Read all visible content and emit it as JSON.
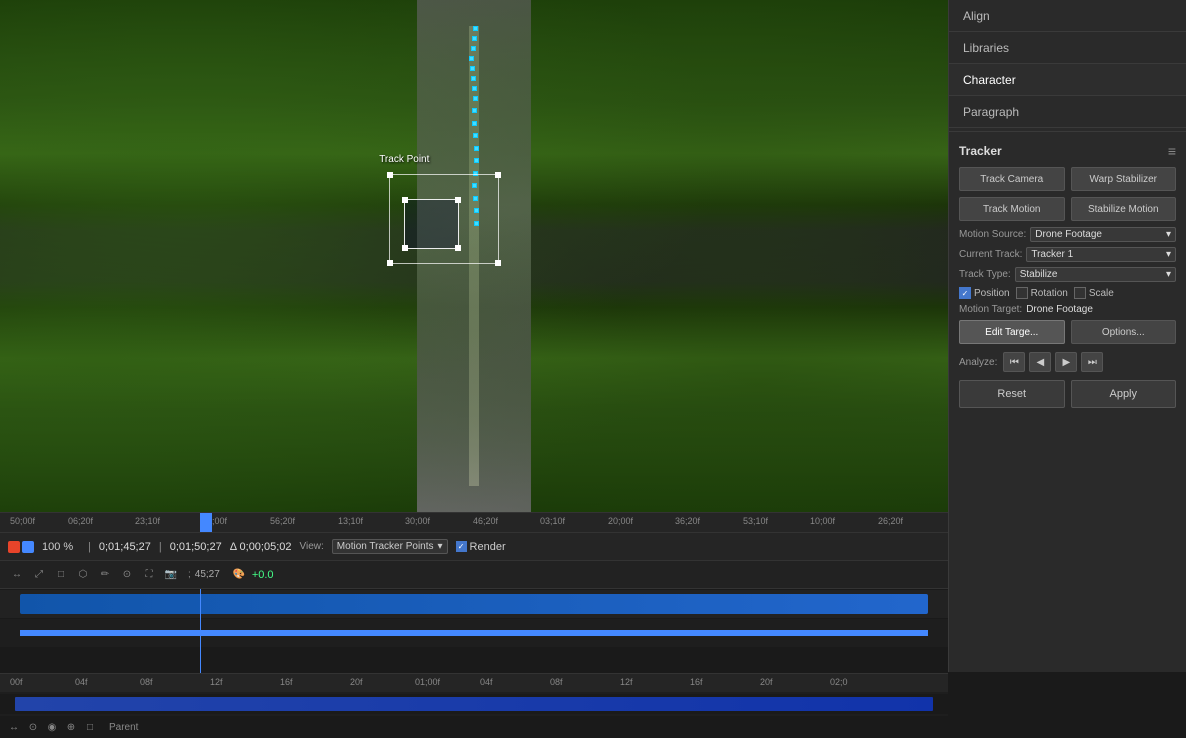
{
  "panels": {
    "align": {
      "label": "Align"
    },
    "libraries": {
      "label": "Libraries"
    },
    "character": {
      "label": "Character"
    },
    "paragraph": {
      "label": "Paragraph"
    }
  },
  "tracker": {
    "title": "Tracker",
    "buttons": {
      "track_camera": "Track Camera",
      "warp_stabilizer": "Warp Stabilizer",
      "track_motion": "Track Motion",
      "stabilize_motion": "Stabilize Motion"
    },
    "motion_source_label": "Motion Source:",
    "motion_source_value": "Drone Footage",
    "current_track_label": "Current Track:",
    "current_track_value": "Tracker 1",
    "track_type_label": "Track Type:",
    "track_type_value": "Stabilize",
    "position_label": "Position",
    "rotation_label": "Rotation",
    "scale_label": "Scale",
    "motion_target_label": "Motion Target:",
    "motion_target_value": "Drone Footage",
    "edit_target_btn": "Edit Targe...",
    "options_btn": "Options...",
    "analyze_label": "Analyze:",
    "reset_btn": "Reset",
    "apply_btn": "Apply"
  },
  "timeline": {
    "zoom": "100 %",
    "time_current": "0;01;45;27",
    "time_in": "0;01;50;27",
    "time_delta": "Δ 0;00;05;02",
    "view_label": "View:",
    "view_value": "Motion Tracker Points",
    "render_label": "Render",
    "ruler_marks": [
      "50;00f",
      "06;20f",
      "23;10f",
      "40;00f",
      "56;20f",
      "13;10f",
      "30;00f",
      "46;20f",
      "03;10f",
      "20;00f",
      "36;20f",
      "53;10f",
      "10;00f",
      "26;20f"
    ],
    "bottom_ruler_marks": [
      "00f",
      "04f",
      "08f",
      "12f",
      "16f",
      "20f",
      "01;00f",
      "04f",
      "08f",
      "12f",
      "16f",
      "20f",
      "02;0"
    ],
    "tc_offset": "+0.0",
    "parent_label": "Parent"
  },
  "tracker_label": "Track Point",
  "icons": {
    "analyze_prev_all": "⏮",
    "analyze_prev": "◀",
    "analyze_next": "▶",
    "analyze_next_all": "⏭",
    "chevron_down": "▾",
    "menu_dots": "≡",
    "checkbox_checked": "✓"
  }
}
